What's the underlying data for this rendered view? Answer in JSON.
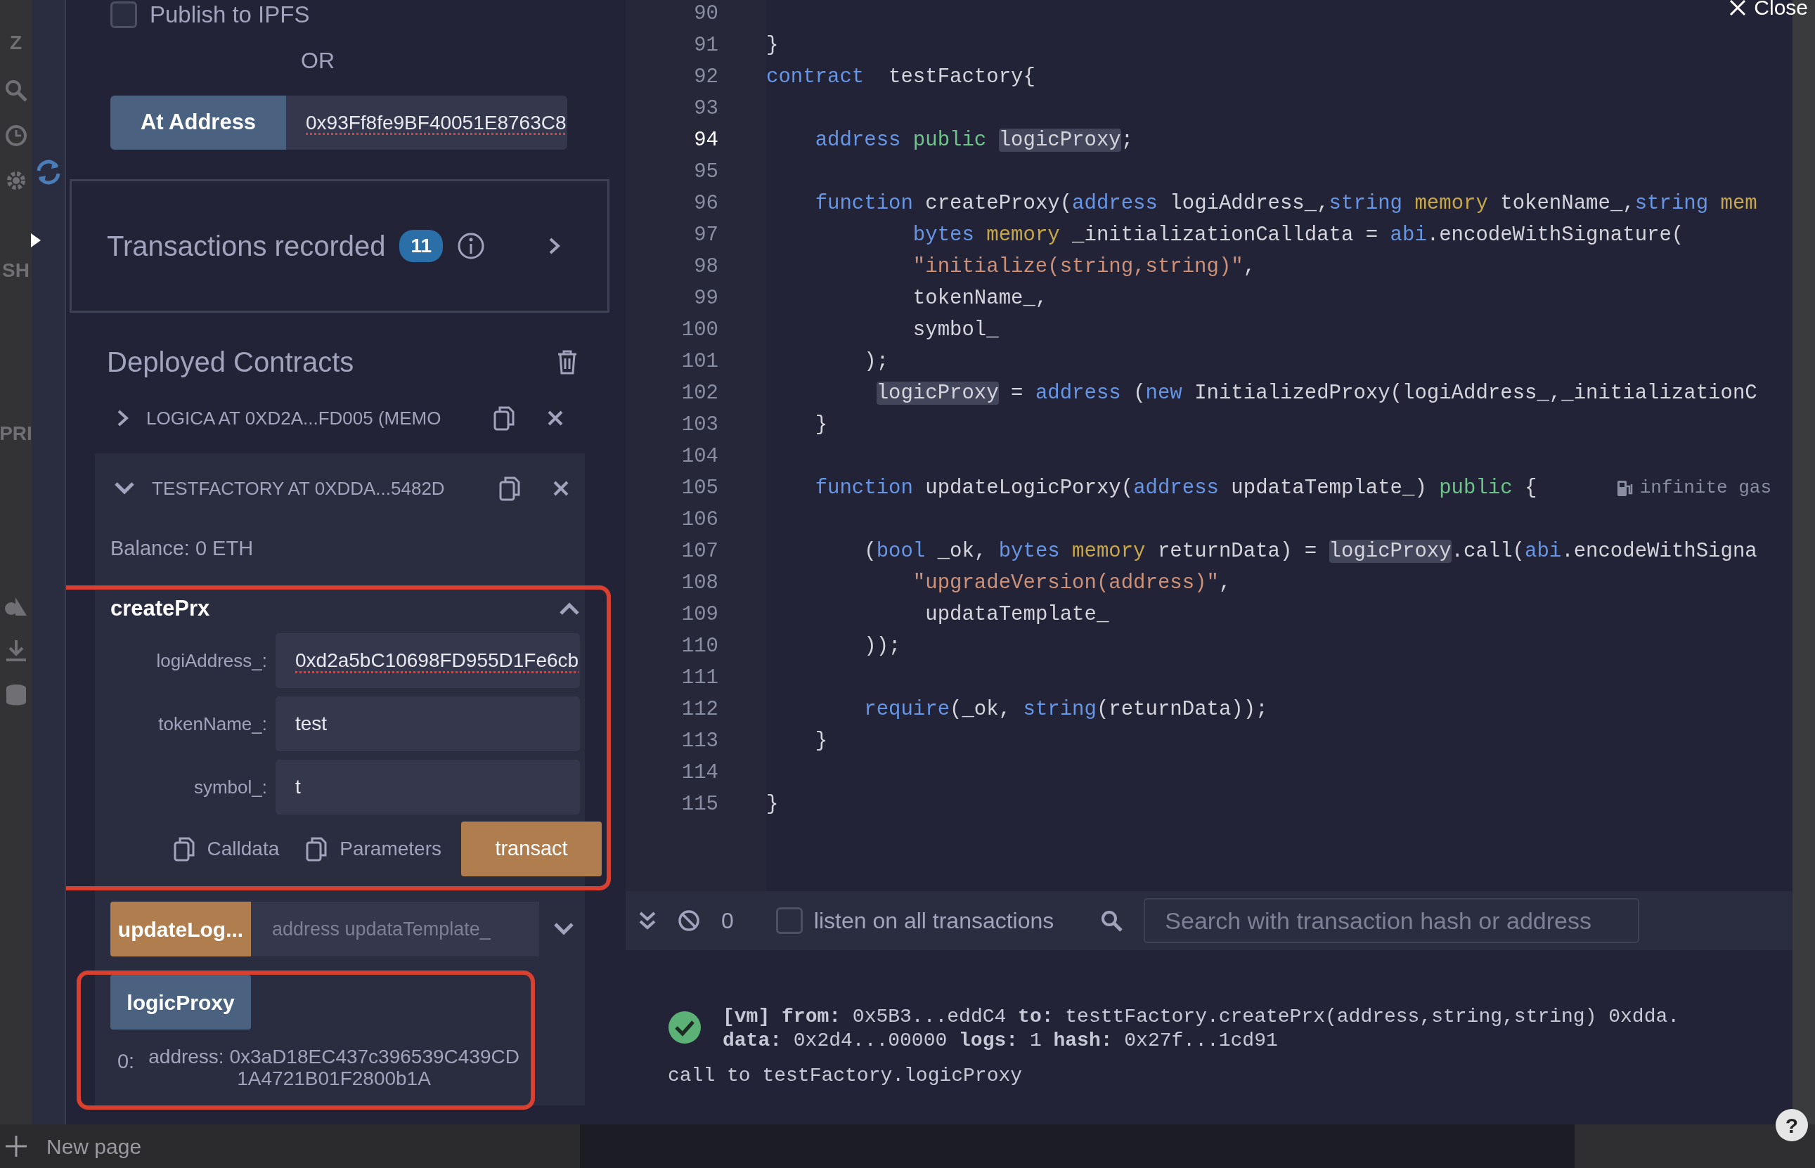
{
  "sidebar_strip": {
    "labels": [
      "Z",
      "SH",
      "PRI"
    ]
  },
  "publish": {
    "label": "Publish to IPFS",
    "checked": false
  },
  "or_text": "OR",
  "at_address": {
    "button": "At Address",
    "value": "0x93Ff8fe9BF40051E8763C8"
  },
  "transactions": {
    "title": "Transactions recorded",
    "count": "11"
  },
  "deployed": {
    "title": "Deployed Contracts",
    "contracts": [
      {
        "name": "LOGICA AT 0XD2A...FD005 (MEMO",
        "expanded": false
      },
      {
        "name": "TESTFACTORY AT 0XDDA...5482D",
        "expanded": true,
        "balance": "Balance: 0 ETH"
      }
    ]
  },
  "create_function": {
    "name": "createPrx",
    "expanded": true,
    "highlighted": true,
    "params": [
      {
        "label": "logiAddress_:",
        "value": "0xd2a5bC10698FD955D1Fe6cb"
      },
      {
        "label": "tokenName_:",
        "value": "test"
      },
      {
        "label": "symbol_:",
        "value": "t"
      }
    ],
    "actions": [
      "Calldata",
      "Parameters"
    ],
    "submit": "transact"
  },
  "functions": [
    {
      "kind": "transact",
      "name": "updateLog...",
      "placeholder": "address updataTemplate_"
    },
    {
      "kind": "call",
      "name": "logicProxy",
      "highlighted": true,
      "result_index": "0:",
      "result": "address: 0x3aD18EC437c396539C439CD1A4721B01F2800b1A"
    }
  ],
  "editor": {
    "lines": [
      {
        "number": "90",
        "current": false
      },
      {
        "number": "91",
        "current": false,
        "tokens": [
          {
            "kind": "plain",
            "text": "}"
          }
        ]
      },
      {
        "number": "92",
        "current": false,
        "tokens": [
          {
            "kind": "kw",
            "text": "contract"
          },
          {
            "kind": "plain",
            "text": "  testFactory{"
          }
        ]
      },
      {
        "number": "93",
        "current": false
      },
      {
        "number": "94",
        "current": true,
        "tokens": [
          {
            "kind": "kw",
            "text": "    address"
          },
          {
            "kind": "pub",
            "text": " public"
          },
          {
            "kind": "hl",
            "text": " logicProxy"
          },
          {
            "kind": "plain",
            "text": ";"
          }
        ]
      },
      {
        "number": "95",
        "current": false
      },
      {
        "number": "96",
        "current": false,
        "tokens": [
          {
            "kind": "kw",
            "text": "    function"
          },
          {
            "kind": "plain",
            "text": " createProxy("
          },
          {
            "kind": "kw",
            "text": "address"
          },
          {
            "kind": "plain",
            "text": " logiAddress_,"
          },
          {
            "kind": "kw",
            "text": "string"
          },
          {
            "kind": "mem",
            "text": " memory"
          },
          {
            "kind": "plain",
            "text": " tokenName_,"
          },
          {
            "kind": "kw",
            "text": "string"
          },
          {
            "kind": "mem",
            "text": " mem"
          }
        ]
      },
      {
        "number": "97",
        "current": false,
        "tokens": [
          {
            "kind": "kw",
            "text": "            bytes"
          },
          {
            "kind": "mem",
            "text": " memory"
          },
          {
            "kind": "plain",
            "text": " _initializationCalldata = "
          },
          {
            "kind": "kw",
            "text": "abi"
          },
          {
            "kind": "plain",
            "text": ".encodeWithSignature("
          }
        ]
      },
      {
        "number": "98",
        "current": false,
        "tokens": [
          {
            "kind": "str",
            "text": "            \"initialize(string,string)\""
          },
          {
            "kind": "plain",
            "text": ","
          }
        ]
      },
      {
        "number": "99",
        "current": false,
        "tokens": [
          {
            "kind": "plain",
            "text": "            tokenName_,"
          }
        ]
      },
      {
        "number": "100",
        "current": false,
        "tokens": [
          {
            "kind": "plain",
            "text": "            symbol_"
          }
        ]
      },
      {
        "number": "101",
        "current": false,
        "tokens": [
          {
            "kind": "plain",
            "text": "        );"
          }
        ]
      },
      {
        "number": "102",
        "current": false,
        "tokens": [
          {
            "kind": "hl",
            "text": "         logicProxy"
          },
          {
            "kind": "plain",
            "text": " = "
          },
          {
            "kind": "kw",
            "text": "address"
          },
          {
            "kind": "plain",
            "text": " ("
          },
          {
            "kind": "kw",
            "text": "new"
          },
          {
            "kind": "plain",
            "text": " InitializedProxy(logiAddress_,_initializationC"
          }
        ]
      },
      {
        "number": "103",
        "current": false,
        "tokens": [
          {
            "kind": "plain",
            "text": "    }"
          }
        ]
      },
      {
        "number": "104",
        "current": false
      },
      {
        "number": "105",
        "current": false,
        "hint": "infinite gas",
        "tokens": [
          {
            "kind": "kw",
            "text": "    function"
          },
          {
            "kind": "plain",
            "text": " updateLogicPorxy("
          },
          {
            "kind": "kw",
            "text": "address"
          },
          {
            "kind": "plain",
            "text": " updataTemplate_) "
          },
          {
            "kind": "pub",
            "text": "public"
          },
          {
            "kind": "plain",
            "text": " {"
          }
        ]
      },
      {
        "number": "106",
        "current": false
      },
      {
        "number": "107",
        "current": false,
        "tokens": [
          {
            "kind": "plain",
            "text": "        ("
          },
          {
            "kind": "kw",
            "text": "bool"
          },
          {
            "kind": "plain",
            "text": " _ok, "
          },
          {
            "kind": "kw",
            "text": "bytes"
          },
          {
            "kind": "mem",
            "text": " memory"
          },
          {
            "kind": "plain",
            "text": " returnData) = "
          },
          {
            "kind": "hl",
            "text": "logicProxy"
          },
          {
            "kind": "plain",
            "text": ".call("
          },
          {
            "kind": "kw",
            "text": "abi"
          },
          {
            "kind": "plain",
            "text": ".encodeWithSigna"
          }
        ]
      },
      {
        "number": "108",
        "current": false,
        "tokens": [
          {
            "kind": "str",
            "text": "            \"upgradeVersion(address)\""
          },
          {
            "kind": "plain",
            "text": ","
          }
        ]
      },
      {
        "number": "109",
        "current": false,
        "tokens": [
          {
            "kind": "plain",
            "text": "             updataTemplate_"
          }
        ]
      },
      {
        "number": "110",
        "current": false,
        "tokens": [
          {
            "kind": "plain",
            "text": "        ));"
          }
        ]
      },
      {
        "number": "111",
        "current": false
      },
      {
        "number": "112",
        "current": false,
        "tokens": [
          {
            "kind": "kw",
            "text": "        require"
          },
          {
            "kind": "plain",
            "text": "(_ok, "
          },
          {
            "kind": "kw",
            "text": "string"
          },
          {
            "kind": "plain",
            "text": "(returnData));"
          }
        ]
      },
      {
        "number": "113",
        "current": false,
        "tokens": [
          {
            "kind": "plain",
            "text": "    }"
          }
        ]
      },
      {
        "number": "114",
        "current": false
      },
      {
        "number": "115",
        "current": false,
        "tokens": [
          {
            "kind": "plain",
            "text": "}"
          }
        ]
      }
    ]
  },
  "console": {
    "count": "0",
    "listen": {
      "label": "listen on all transactions",
      "checked": false
    },
    "search_placeholder": "Search with transaction hash or address",
    "logs": [
      {
        "kind": "success",
        "lines": [
          "**[vm]**  **from:** 0x5B3...eddC4 **to:** testtFactory.createPrx(address,string,string) 0xdda.",
          "**data:** 0x2d4...00000 **logs:** 1 **hash:** 0x27f...1cd91"
        ]
      },
      {
        "kind": "call",
        "lines": [
          "call to testFactory.logicProxy"
        ]
      }
    ]
  },
  "footer": {
    "new_page": "New page"
  },
  "overlay": {
    "close": "Close",
    "help": "?"
  }
}
